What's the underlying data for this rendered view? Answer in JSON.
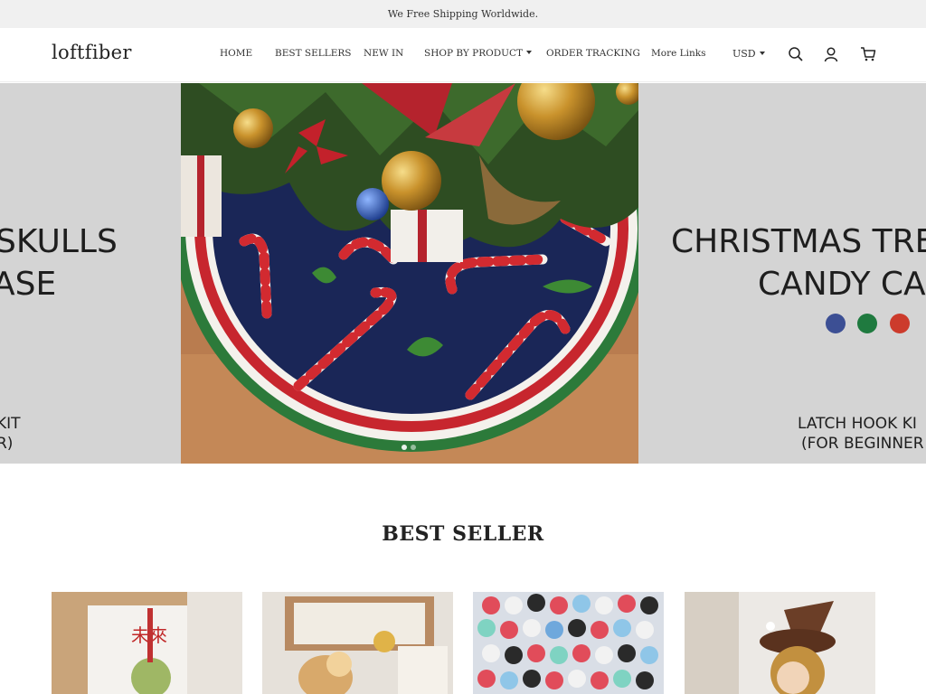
{
  "announcement": "We Free Shipping Worldwide.",
  "header": {
    "logo": "loftfiber",
    "nav": [
      {
        "label": "HOME"
      },
      {
        "label": "BEST SELLERS"
      },
      {
        "label": "NEW IN"
      },
      {
        "label": "SHOP BY PRODUCT",
        "dropdown": true
      },
      {
        "label": "ORDER TRACKING"
      },
      {
        "label": "More Links"
      }
    ],
    "currency": "USD",
    "icons": [
      "search-icon",
      "account-icon",
      "cart-icon"
    ]
  },
  "hero": {
    "left_slide": {
      "line1": "SKULLS",
      "line2": "ASE",
      "line3": "KIT",
      "line4": "R)"
    },
    "right_slide": {
      "line1": "CHRISTMAS TRE",
      "line2": "CANDY CA",
      "line3": "LATCH HOOK KI",
      "line4": "(FOR BEGINNER",
      "colors": [
        "#3c4f94",
        "#1f7a3f",
        "#cc3b2c"
      ]
    }
  },
  "best_seller": {
    "title": "BEST SELLER",
    "products": [
      {
        "name": "product-card-1"
      },
      {
        "name": "product-card-2"
      },
      {
        "name": "product-card-3"
      },
      {
        "name": "product-card-4"
      }
    ]
  },
  "colors": {
    "announcement_bg": "#f0f0f0",
    "hero_bg": "#d4d4d4",
    "text": "#222222"
  }
}
